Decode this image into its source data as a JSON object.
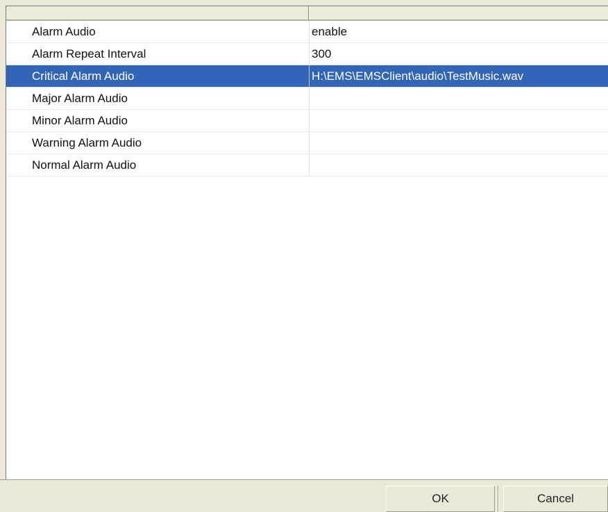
{
  "table": {
    "columns": [
      "",
      ""
    ],
    "rows": [
      {
        "name": "Alarm Audio",
        "value": "enable",
        "selected": false
      },
      {
        "name": "Alarm Repeat Interval",
        "value": "300",
        "selected": false
      },
      {
        "name": "Critical Alarm Audio",
        "value": "H:\\EMS\\EMSClient\\audio\\TestMusic.wav",
        "selected": true
      },
      {
        "name": "Major Alarm Audio",
        "value": "",
        "selected": false
      },
      {
        "name": "Minor Alarm Audio",
        "value": "",
        "selected": false
      },
      {
        "name": "Warning Alarm Audio",
        "value": "",
        "selected": false
      },
      {
        "name": "Normal Alarm Audio",
        "value": "",
        "selected": false
      }
    ]
  },
  "buttons": {
    "ok_label": "OK",
    "cancel_label": "Cancel"
  },
  "colors": {
    "selection": "#3264b8",
    "window_bg": "#ece9d8"
  }
}
